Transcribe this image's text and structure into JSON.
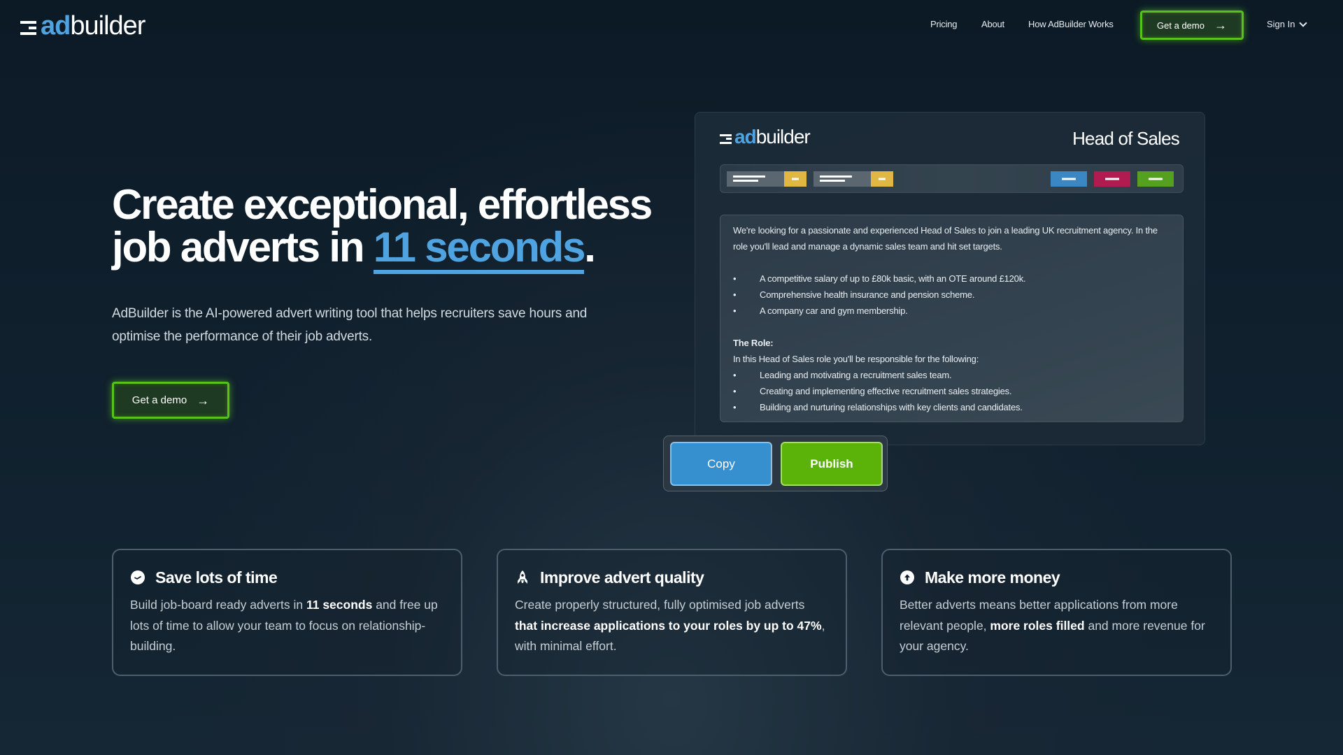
{
  "nav": {
    "logo": {
      "prefix": "ad",
      "suffix": "builder",
      "icon": "menu-lines-icon"
    },
    "links": [
      {
        "label": "Pricing"
      },
      {
        "label": "About"
      },
      {
        "label": "How AdBuilder Works"
      }
    ],
    "demo_button": {
      "label": "Get a demo",
      "icon": "arrow-right-icon"
    },
    "sign_in": {
      "label": "Sign In",
      "icon": "chevron-down-icon"
    }
  },
  "hero": {
    "title_line1": "Create exceptional, effortless",
    "title_line2_prefix": "job adverts in ",
    "title_accent": "11 seconds",
    "title_suffix": ".",
    "subtitle": "AdBuilder is the AI-powered advert writing tool that helps recruiters save hours and optimise the performance of their job adverts.",
    "demo_button": {
      "label": "Get a demo",
      "icon": "arrow-right-icon"
    }
  },
  "mockup": {
    "logo": {
      "prefix": "ad",
      "suffix": "builder"
    },
    "job_title": "Head of Sales",
    "toolbar": {
      "selects": [
        {
          "name": "option-select-1",
          "toggle_color": "#e1b743"
        },
        {
          "name": "option-select-2",
          "toggle_color": "#e1b743"
        }
      ],
      "buttons": [
        {
          "name": "blue-action",
          "color": "#3a87c4"
        },
        {
          "name": "red-action",
          "color": "#b01c4f"
        },
        {
          "name": "green-action",
          "color": "#55a01e"
        }
      ]
    },
    "advert": {
      "intro": "We're looking for a passionate and experienced Head of Sales to join a leading UK recruitment agency. In the role you'll lead and manage a dynamic sales team and hit set targets.",
      "benefits": [
        "A competitive salary of up to £80k basic, with an OTE around £120k.",
        "Comprehensive health insurance and pension scheme.",
        "A company car and gym membership."
      ],
      "role_heading": "The Role:",
      "role_intro": "In this Head of Sales role you'll be responsible for the following:",
      "responsibilities": [
        "Leading and motivating a recruitment sales team.",
        "Creating and implementing effective recruitment sales strategies.",
        "Building and nurturing relationships with key clients and candidates."
      ]
    },
    "actions": {
      "copy": "Copy",
      "publish": "Publish"
    }
  },
  "features": [
    {
      "icon": "clock-icon",
      "title": "Save lots of time",
      "body_pre": "Build job-board ready adverts in ",
      "body_bold": "11 seconds",
      "body_post": " and free up lots of time to allow your team to focus on relationship-building."
    },
    {
      "icon": "rocket-icon",
      "title": "Improve advert quality",
      "body_pre": "Create properly structured, fully optimised job adverts ",
      "body_bold": "that increase applications to your roles by up to 47%",
      "body_post": ", with minimal effort."
    },
    {
      "icon": "arrow-up-circle-icon",
      "title": "Make more money",
      "body_pre": "Better adverts means better applications from more relevant people, ",
      "body_bold": "more roles filled",
      "body_post": " and more revenue for your agency."
    }
  ],
  "colors": {
    "accent_blue": "#4fa3e0",
    "cta_green": "#58c11a",
    "copy_blue": "#3690d0",
    "publish_green": "#5bb30a",
    "background": "#0c1a26"
  }
}
